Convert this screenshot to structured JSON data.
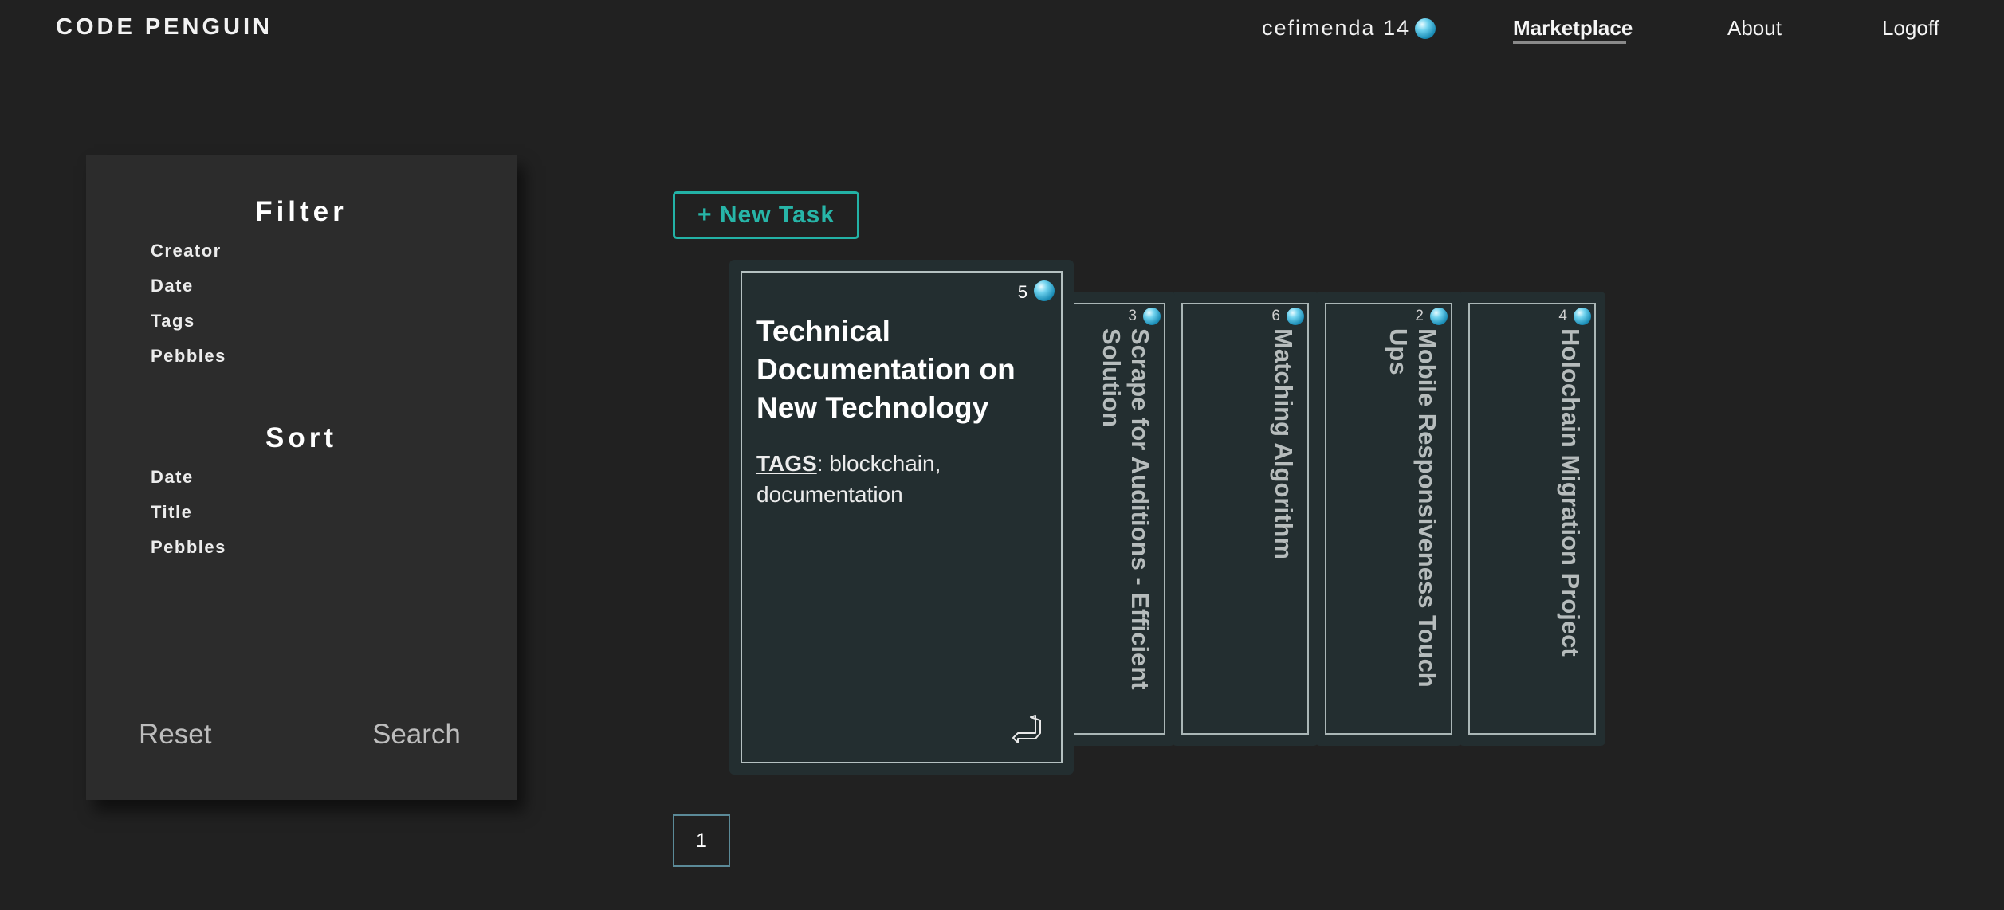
{
  "header": {
    "brand": "CODE PENGUIN",
    "user_label": "cefimenda 14",
    "nav": [
      {
        "label": "Marketplace",
        "active": true
      },
      {
        "label": "About",
        "active": false
      },
      {
        "label": "Logoff",
        "active": false
      }
    ]
  },
  "filter_panel": {
    "filter_heading": "Filter",
    "filter_items": [
      "Creator",
      "Date",
      "Tags",
      "Pebbles"
    ],
    "sort_heading": "Sort",
    "sort_items": [
      "Date",
      "Title",
      "Pebbles"
    ],
    "reset_label": "Reset",
    "search_label": "Search"
  },
  "toolbar": {
    "new_task_label": "+ New Task"
  },
  "cards": {
    "front": {
      "pebbles": "5",
      "title": "Technical Documentation on New Technology",
      "tags_label": "TAGS",
      "tags_value": ": blockchain, documentation"
    },
    "stack": [
      {
        "pebbles": "3",
        "title": "Scrape for Auditions - Efficient Solution"
      },
      {
        "pebbles": "6",
        "title": "Matching Algorithm"
      },
      {
        "pebbles": "2",
        "title": "Mobile Responsiveness Touch Ups"
      },
      {
        "pebbles": "4",
        "title": "Holochain Migration Project"
      }
    ]
  },
  "pagination": {
    "current_page": "1"
  },
  "icons": {
    "pebble": "pebble-icon",
    "flip": "flip-card-icon"
  },
  "colors": {
    "background": "#212121",
    "panel": "#2c2c2c",
    "card": "#232e30",
    "accent": "#23b2a6"
  }
}
